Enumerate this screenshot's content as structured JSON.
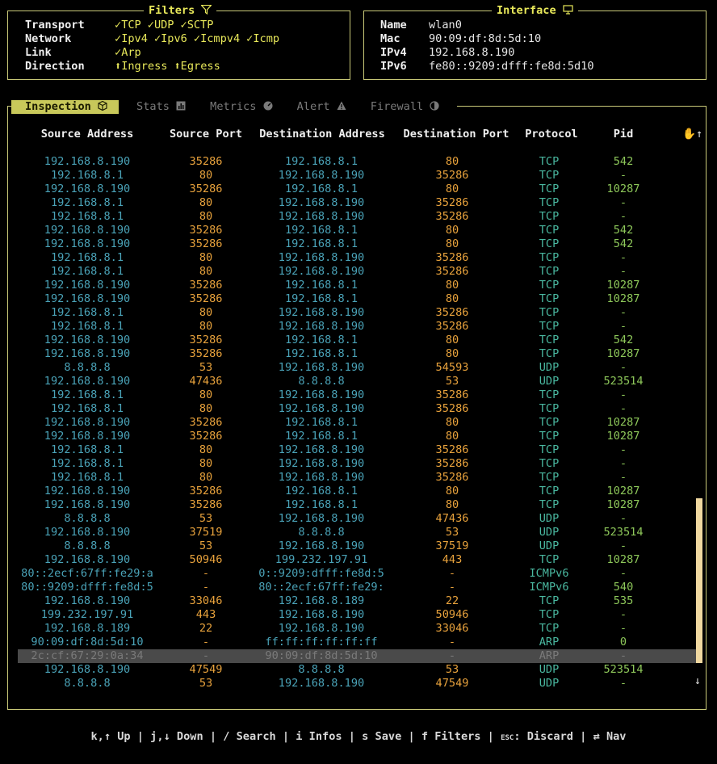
{
  "filters": {
    "title": "Filters",
    "icon": "filter-icon",
    "rows": [
      {
        "label": "Transport",
        "items": [
          "TCP",
          "UDP",
          "SCTP"
        ],
        "mark": "✓"
      },
      {
        "label": "Network",
        "items": [
          "Ipv4",
          "Ipv6",
          "Icmpv4",
          "Icmp"
        ],
        "mark": "✓"
      },
      {
        "label": "Link",
        "items": [
          "Arp"
        ],
        "mark": "✓"
      },
      {
        "label": "Direction",
        "items": [
          "Ingress",
          "Egress"
        ],
        "mark": "⬆"
      }
    ]
  },
  "interface": {
    "title": "Interface",
    "icon": "monitor-icon",
    "rows": [
      {
        "label": "Name",
        "value": "wlan0"
      },
      {
        "label": "Mac",
        "value": "90:09:df:8d:5d:10"
      },
      {
        "label": "IPv4",
        "value": "192.168.8.190"
      },
      {
        "label": "IPv6",
        "value": "fe80::9209:dfff:fe8d:5d10"
      }
    ]
  },
  "tabs": [
    {
      "label": "Inspection",
      "icon": "cube-icon",
      "active": true
    },
    {
      "label": "Stats",
      "icon": "bar-chart-icon",
      "active": false
    },
    {
      "label": "Metrics",
      "icon": "gauge-icon",
      "active": false
    },
    {
      "label": "Alert",
      "icon": "warning-icon",
      "active": false
    },
    {
      "label": "Firewall",
      "icon": "shield-icon",
      "active": false
    }
  ],
  "table": {
    "headers": [
      "Source Address",
      "Source Port",
      "Destination Address",
      "Destination Port",
      "Protocol",
      "Pid"
    ],
    "rows": [
      [
        "192.168.8.190",
        "35286",
        "192.168.8.1",
        "80",
        "TCP",
        "542"
      ],
      [
        "192.168.8.1",
        "80",
        "192.168.8.190",
        "35286",
        "TCP",
        "-"
      ],
      [
        "192.168.8.190",
        "35286",
        "192.168.8.1",
        "80",
        "TCP",
        "10287"
      ],
      [
        "192.168.8.1",
        "80",
        "192.168.8.190",
        "35286",
        "TCP",
        "-"
      ],
      [
        "192.168.8.1",
        "80",
        "192.168.8.190",
        "35286",
        "TCP",
        "-"
      ],
      [
        "192.168.8.190",
        "35286",
        "192.168.8.1",
        "80",
        "TCP",
        "542"
      ],
      [
        "192.168.8.190",
        "35286",
        "192.168.8.1",
        "80",
        "TCP",
        "542"
      ],
      [
        "192.168.8.1",
        "80",
        "192.168.8.190",
        "35286",
        "TCP",
        "-"
      ],
      [
        "192.168.8.1",
        "80",
        "192.168.8.190",
        "35286",
        "TCP",
        "-"
      ],
      [
        "192.168.8.190",
        "35286",
        "192.168.8.1",
        "80",
        "TCP",
        "10287"
      ],
      [
        "192.168.8.190",
        "35286",
        "192.168.8.1",
        "80",
        "TCP",
        "10287"
      ],
      [
        "192.168.8.1",
        "80",
        "192.168.8.190",
        "35286",
        "TCP",
        "-"
      ],
      [
        "192.168.8.1",
        "80",
        "192.168.8.190",
        "35286",
        "TCP",
        "-"
      ],
      [
        "192.168.8.190",
        "35286",
        "192.168.8.1",
        "80",
        "TCP",
        "542"
      ],
      [
        "192.168.8.190",
        "35286",
        "192.168.8.1",
        "80",
        "TCP",
        "10287"
      ],
      [
        "8.8.8.8",
        "53",
        "192.168.8.190",
        "54593",
        "UDP",
        "-"
      ],
      [
        "192.168.8.190",
        "47436",
        "8.8.8.8",
        "53",
        "UDP",
        "523514"
      ],
      [
        "192.168.8.1",
        "80",
        "192.168.8.190",
        "35286",
        "TCP",
        "-"
      ],
      [
        "192.168.8.1",
        "80",
        "192.168.8.190",
        "35286",
        "TCP",
        "-"
      ],
      [
        "192.168.8.190",
        "35286",
        "192.168.8.1",
        "80",
        "TCP",
        "10287"
      ],
      [
        "192.168.8.190",
        "35286",
        "192.168.8.1",
        "80",
        "TCP",
        "10287"
      ],
      [
        "192.168.8.1",
        "80",
        "192.168.8.190",
        "35286",
        "TCP",
        "-"
      ],
      [
        "192.168.8.1",
        "80",
        "192.168.8.190",
        "35286",
        "TCP",
        "-"
      ],
      [
        "192.168.8.1",
        "80",
        "192.168.8.190",
        "35286",
        "TCP",
        "-"
      ],
      [
        "192.168.8.190",
        "35286",
        "192.168.8.1",
        "80",
        "TCP",
        "10287"
      ],
      [
        "192.168.8.190",
        "35286",
        "192.168.8.1",
        "80",
        "TCP",
        "10287"
      ],
      [
        "8.8.8.8",
        "53",
        "192.168.8.190",
        "47436",
        "UDP",
        "-"
      ],
      [
        "192.168.8.190",
        "37519",
        "8.8.8.8",
        "53",
        "UDP",
        "523514"
      ],
      [
        "8.8.8.8",
        "53",
        "192.168.8.190",
        "37519",
        "UDP",
        "-"
      ],
      [
        "192.168.8.190",
        "50946",
        "199.232.197.91",
        "443",
        "TCP",
        "10287"
      ],
      [
        "80::2ecf:67ff:fe29:a",
        "-",
        "0::9209:dfff:fe8d:5",
        "-",
        "ICMPv6",
        "-"
      ],
      [
        "80::9209:dfff:fe8d:5",
        "-",
        "80::2ecf:67ff:fe29:",
        "-",
        "ICMPv6",
        "540"
      ],
      [
        "192.168.8.190",
        "33046",
        "192.168.8.189",
        "22",
        "TCP",
        "535"
      ],
      [
        "199.232.197.91",
        "443",
        "192.168.8.190",
        "50946",
        "TCP",
        "-"
      ],
      [
        "192.168.8.189",
        "22",
        "192.168.8.190",
        "33046",
        "TCP",
        "-"
      ],
      [
        "90:09:df:8d:5d:10",
        "-",
        "ff:ff:ff:ff:ff:ff",
        "-",
        "ARP",
        "0"
      ],
      [
        "2c:cf:67:29:0a:34",
        "-",
        "90:09:df:8d:5d:10",
        "-",
        "ARP",
        "-"
      ],
      [
        "192.168.8.190",
        "47549",
        "8.8.8.8",
        "53",
        "UDP",
        "523514"
      ],
      [
        "8.8.8.8",
        "53",
        "192.168.8.190",
        "47549",
        "UDP",
        "-"
      ]
    ],
    "selected_row": 36,
    "scroll_up": "↑",
    "scroll_down": "↓",
    "sort_icon": "hand-icon"
  },
  "footer": {
    "items": [
      {
        "key": "k,↑",
        "action": "Up"
      },
      {
        "key": "j,↓",
        "action": "Down"
      },
      {
        "key": "/",
        "action": "Search"
      },
      {
        "key": "i",
        "action": "Infos"
      },
      {
        "key": "s",
        "action": "Save"
      },
      {
        "key": "f",
        "action": "Filters"
      },
      {
        "key": "ESC",
        "action": ": Discard"
      },
      {
        "key": "⇄",
        "action": "Nav"
      }
    ]
  }
}
